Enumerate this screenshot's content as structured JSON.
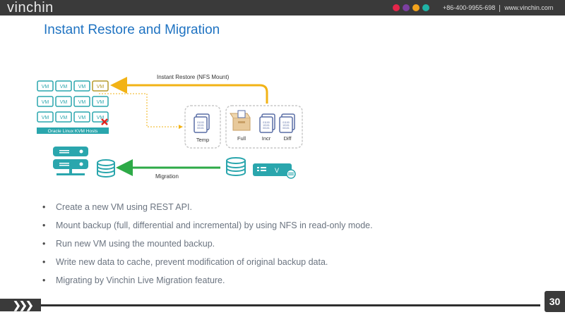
{
  "header": {
    "logo": "vinchin",
    "phone": "+86-400-9955-698",
    "website": "www.vinchin.com",
    "dot_colors": [
      "#e4254a",
      "#7b3fa0",
      "#f2a31c",
      "#1fb3a6"
    ]
  },
  "title": "Instant Restore and Migration",
  "diagram": {
    "restore_label": "Instant Restore  (NFS Mount)",
    "migration_label": "Migration",
    "vm_label": "VM",
    "hosts_label": "Oracle Linux KVM  Hosts",
    "temp_label": "Temp",
    "full_label": "Full",
    "incr_label": "Incr",
    "diff_label": "Diff",
    "v_label": "V",
    "restore_color": "#f2b316",
    "migration_color": "#2daa47",
    "accent_teal": "#2aa6ad"
  },
  "bullets": [
    "Create a new VM using REST API.",
    "Mount backup (full, differential and incremental) by using NFS in read-only mode.",
    "Run new VM using the mounted backup.",
    "Write new data to cache, prevent modification of original backup data.",
    "Migrating by Vinchin Live Migration feature."
  ],
  "footer": {
    "page_number": "30"
  }
}
